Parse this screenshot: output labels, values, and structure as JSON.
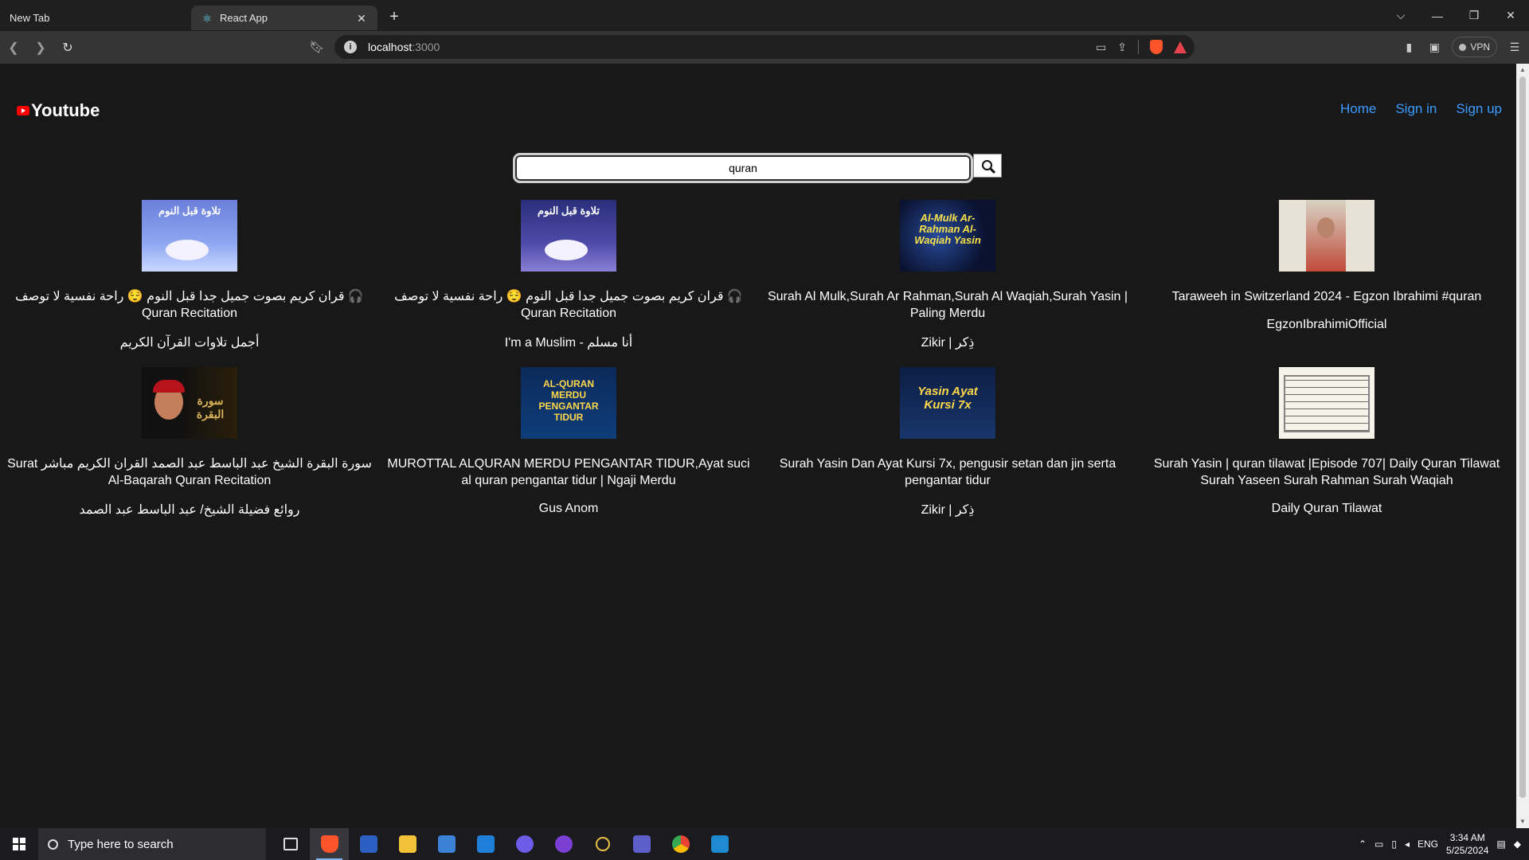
{
  "browser": {
    "tabs": [
      {
        "title": "New Tab",
        "active": false
      },
      {
        "title": "React App",
        "active": true
      }
    ],
    "url_host": "localhost",
    "url_port": ":3000",
    "vpn_label": "VPN"
  },
  "app": {
    "logo_text": "Youtube",
    "nav": [
      "Home",
      "Sign in",
      "Sign up"
    ],
    "search": {
      "value": "quran"
    }
  },
  "videos": [
    {
      "title": "🎧 قران كريم بصوت جميل جدا قبل النوم 😌 راحة نفسية لا توصف Quran Recitation",
      "channel": "أجمل تلاوات القرآن الكريم",
      "thumb_text": "تلاوة قبل النوم"
    },
    {
      "title": "🎧 قران كريم بصوت جميل جدا قبل النوم 😌 راحة نفسية لا توصف Quran Recitation",
      "channel": "أنا مسلم - I'm a Muslim",
      "thumb_text": "تلاوة قبل النوم"
    },
    {
      "title": "Surah Al Mulk,Surah Ar Rahman,Surah Al Waqiah,Surah Yasin | Paling Merdu",
      "channel": "Zikir | ذِكر",
      "thumb_text": "Al-Mulk Ar-Rahman Al-Waqiah Yasin"
    },
    {
      "title": "Taraweeh in Switzerland 2024 - Egzon Ibrahimi #quran",
      "channel": "EgzonIbrahimiOfficial",
      "thumb_text": ""
    },
    {
      "title": "سورة البقرة الشيخ عبد الباسط عبد الصمد القران الكريم مباشر Surat Al-Baqarah Quran Recitation",
      "channel": "روائع فضيلة الشيخ/ عبد الباسط عبد الصمد",
      "thumb_text": "سورة البقرة"
    },
    {
      "title": "MUROTTAL ALQURAN MERDU PENGANTAR TIDUR,Ayat suci al quran pengantar tidur | Ngaji Merdu",
      "channel": "Gus Anom",
      "thumb_text": "AL-QURAN MERDU PENGANTAR TIDUR"
    },
    {
      "title": "Surah Yasin Dan Ayat Kursi 7x, pengusir setan dan jin serta pengantar tidur",
      "channel": "Zikir | ذِكر",
      "thumb_text": "Yasin Ayat Kursi 7x"
    },
    {
      "title": "Surah Yasin | quran tilawat |Episode 707| Daily Quran Tilawat Surah Yaseen Surah Rahman Surah Waqiah",
      "channel": "Daily Quran Tilawat",
      "thumb_text": ""
    }
  ],
  "taskbar": {
    "search_placeholder": "Type here to search",
    "lang": "ENG",
    "time": "3:34 AM",
    "date": "5/25/2024"
  },
  "colors": {
    "accent_link": "#3b9cff",
    "page_bg": "#181818",
    "logo_red": "#ff0000"
  }
}
